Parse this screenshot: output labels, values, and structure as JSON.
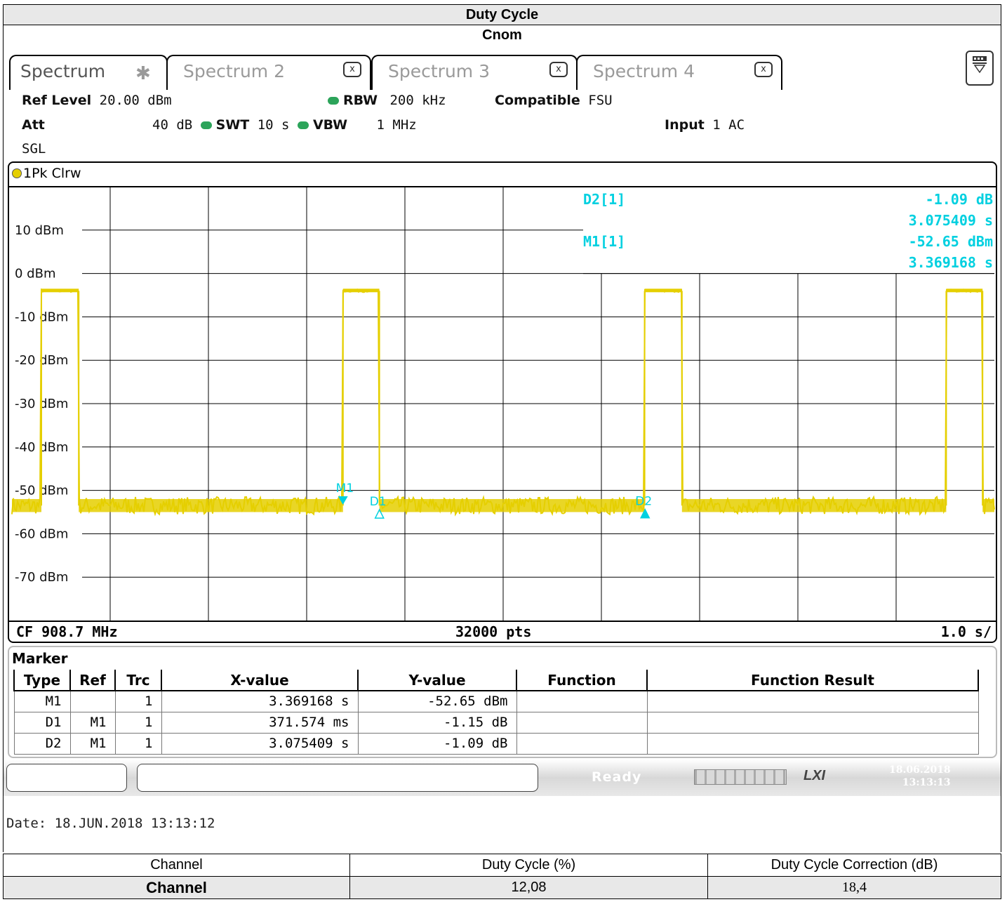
{
  "header": {
    "title": "Duty Cycle",
    "subtitle": "Cnom"
  },
  "tabs": [
    {
      "label": "Spectrum",
      "active": true
    },
    {
      "label": "Spectrum 2",
      "close": "x"
    },
    {
      "label": "Spectrum 3",
      "close": "x"
    },
    {
      "label": "Spectrum 4",
      "close": "x"
    }
  ],
  "settings": {
    "ref_level_label": "Ref Level",
    "ref_level": "20.00 dBm",
    "att_label": "Att",
    "att": "40 dB",
    "swt_label": "SWT",
    "swt": "10 s",
    "rbw_label": "RBW",
    "rbw": "200 kHz",
    "vbw_label": "VBW",
    "vbw": "1 MHz",
    "compat_label": "Compatible",
    "compat": "FSU",
    "input_label": "Input",
    "input": "1 AC",
    "mode": "SGL"
  },
  "trace": {
    "label": "1Pk Clrw",
    "color": "#e5cf00"
  },
  "marker_readout": {
    "d2_label": "D2[1]",
    "d2_y": "-1.09 dB",
    "d2_x": "3.075409 s",
    "m1_label": "M1[1]",
    "m1_y": "-52.65 dBm",
    "m1_x": "3.369168 s",
    "color": "#00d0e0"
  },
  "chart_data": {
    "type": "line",
    "ylabel_unit": "dBm",
    "y_ticks": [
      "10 dBm",
      "0 dBm",
      "-10 dBm",
      "-20 dBm",
      "-30 dBm",
      "-40 dBm",
      "-50 dBm",
      "-60 dBm",
      "-70 dBm"
    ],
    "ylim": [
      -80,
      20
    ],
    "xlim": [
      0,
      10
    ],
    "x_unit": "s",
    "noise_floor_dbm": -53.5,
    "pulse_level_dbm": -4,
    "pulses": [
      [
        0.3,
        0.68
      ],
      [
        3.37,
        3.74
      ],
      [
        6.44,
        6.82
      ],
      [
        9.51,
        9.88
      ]
    ],
    "markers": [
      {
        "name": "M1",
        "x": 3.369168,
        "y": -52.65,
        "symbol": "down"
      },
      {
        "name": "D1",
        "x": 3.740742,
        "y": -53.8,
        "symbol": "up"
      },
      {
        "name": "D2",
        "x": 6.444577,
        "y": -53.74,
        "symbol": "up"
      }
    ]
  },
  "axis_footer": {
    "cf": "CF 908.7 MHz",
    "pts": "32000 pts",
    "span": "1.0 s/"
  },
  "marker_table": {
    "title": "Marker",
    "headers": [
      "Type",
      "Ref",
      "Trc",
      "X-value",
      "Y-value",
      "Function",
      "Function Result"
    ],
    "rows": [
      [
        "M1",
        "",
        "1",
        "3.369168 s",
        "-52.65 dBm",
        "",
        ""
      ],
      [
        "D1",
        "M1",
        "1",
        "371.574 ms",
        "-1.15 dB",
        "",
        ""
      ],
      [
        "D2",
        "M1",
        "1",
        "3.075409 s",
        "-1.09 dB",
        "",
        ""
      ]
    ]
  },
  "status": {
    "ready": "Ready",
    "lxi": "LXI",
    "date": "18.06.2018",
    "time": "13:13:13"
  },
  "screenshot_date": "Date: 18.JUN.2018  13:13:12",
  "results": {
    "headers": [
      "Channel",
      "Duty Cycle (%)",
      "Duty Cycle Correction (dB)"
    ],
    "row": [
      "Channel",
      "12,08",
      "18,4"
    ]
  }
}
